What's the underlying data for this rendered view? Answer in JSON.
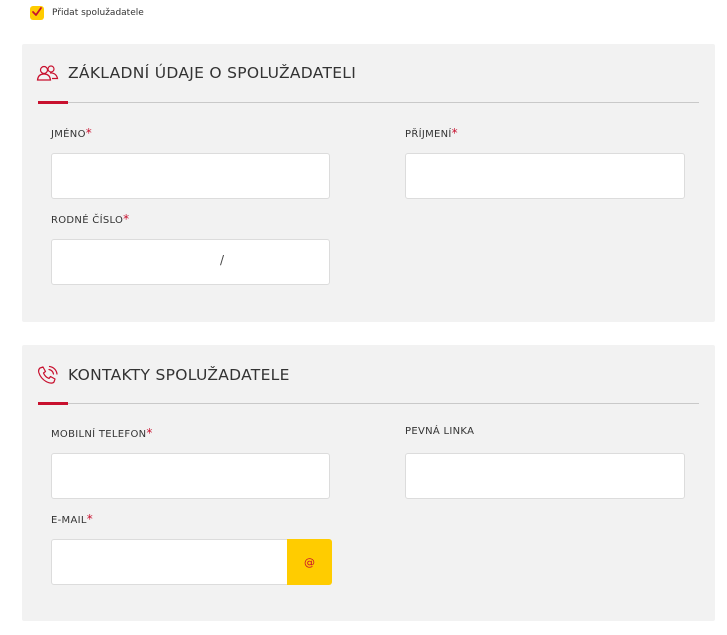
{
  "add_coapplicant": {
    "label": "Přidat spolužadatele",
    "checked": true
  },
  "section_basic": {
    "title": "ZÁKLADNÍ ÚDAJE O SPOLUŽADATELI",
    "icon": "users-icon",
    "fields": {
      "first_name": {
        "label": "JMÉNO",
        "required": "*",
        "value": ""
      },
      "last_name": {
        "label": "PŘÍJMENÍ",
        "required": "*",
        "value": ""
      },
      "birth_number": {
        "label": "RODNÉ ČÍSLO",
        "required": "*",
        "separator": "/"
      }
    }
  },
  "section_contact": {
    "title": "KONTAKTY SPOLUŽADATELE",
    "icon": "phone-icon",
    "fields": {
      "mobile": {
        "label": "MOBILNÍ TELEFON",
        "required": "*",
        "value": ""
      },
      "landline": {
        "label": "PEVNÁ LINKA",
        "value": ""
      },
      "email": {
        "label": "E-MAIL",
        "required": "*",
        "value": "",
        "button": "@"
      }
    }
  },
  "colors": {
    "accent": "#c8102e",
    "brand_yellow": "#ffcc00",
    "panel_bg": "#f2f2f2"
  }
}
